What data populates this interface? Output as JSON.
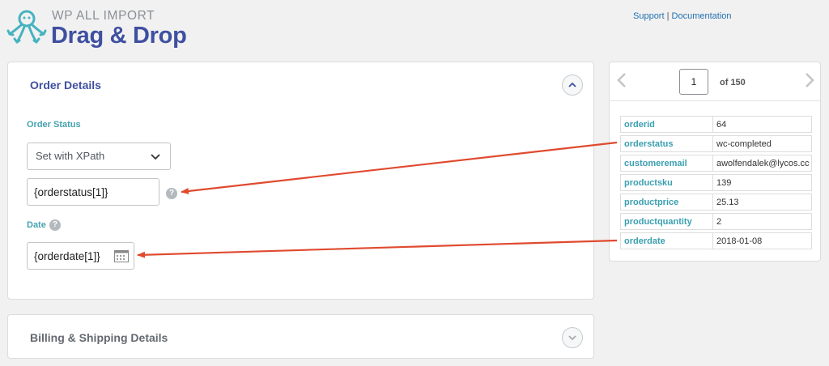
{
  "header": {
    "brand_small": "WP ALL IMPORT",
    "brand_big": "Drag & Drop",
    "support_link": "Support",
    "separator": "|",
    "documentation_link": "Documentation"
  },
  "order_panel": {
    "title": "Order Details",
    "order_status_label": "Order Status",
    "status_select_value": "Set with XPath",
    "status_input_value": "{orderstatus[1]}",
    "date_label": "Date",
    "date_input_value": "{orderdate[1]}"
  },
  "billing_panel": {
    "title": "Billing & Shipping Details"
  },
  "preview": {
    "page_value": "1",
    "of_label": "of 150",
    "rows": [
      {
        "key": "orderid",
        "value": "64"
      },
      {
        "key": "orderstatus",
        "value": "wc-completed"
      },
      {
        "key": "customeremail",
        "value": "awolfendalek@lycos.cc"
      },
      {
        "key": "productsku",
        "value": "139"
      },
      {
        "key": "productprice",
        "value": "25.13"
      },
      {
        "key": "productquantity",
        "value": "2"
      },
      {
        "key": "orderdate",
        "value": "2018-01-08"
      }
    ]
  },
  "colors": {
    "brand": "#3f4fa0",
    "label_teal": "#46a2b0",
    "arrow_red": "#e04a2f"
  },
  "icons": [
    "octopus-logo-icon",
    "chevron-up-icon",
    "chevron-down-icon",
    "help-icon",
    "calendar-icon",
    "chevron-left-icon",
    "chevron-right-icon"
  ]
}
